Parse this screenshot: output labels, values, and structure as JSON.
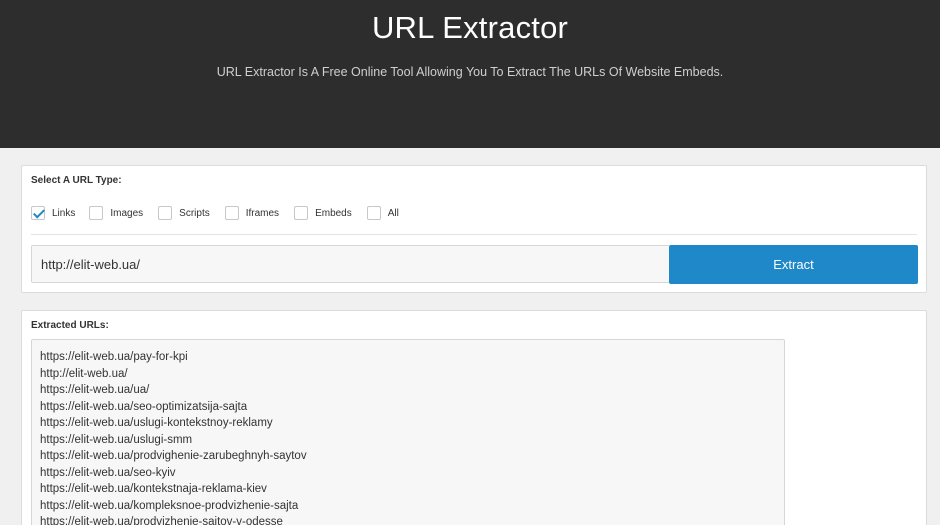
{
  "header": {
    "title": "URL Extractor",
    "subtitle": "URL Extractor Is A Free Online Tool Allowing You To Extract The URLs Of Website Embeds."
  },
  "url_type": {
    "label": "Select A URL Type:",
    "options": [
      {
        "label": "Links",
        "checked": true
      },
      {
        "label": "Images",
        "checked": false
      },
      {
        "label": "Scripts",
        "checked": false
      },
      {
        "label": "Iframes",
        "checked": false
      },
      {
        "label": "Embeds",
        "checked": false
      },
      {
        "label": "All",
        "checked": false
      }
    ]
  },
  "input": {
    "value": "http://elit-web.ua/"
  },
  "extract_button": {
    "label": "Extract"
  },
  "results": {
    "label": "Extracted URLs:",
    "urls": [
      "https://elit-web.ua/pay-for-kpi",
      "http://elit-web.ua/",
      "https://elit-web.ua/ua/",
      "https://elit-web.ua/seo-optimizatsija-sajta",
      "https://elit-web.ua/uslugi-kontekstnoy-reklamy",
      "https://elit-web.ua/uslugi-smm",
      "https://elit-web.ua/prodvighenie-zarubeghnyh-saytov",
      "https://elit-web.ua/seo-kyiv",
      "https://elit-web.ua/kontekstnaja-reklama-kiev",
      "https://elit-web.ua/kompleksnoe-prodvizhenie-sajta",
      "https://elit-web.ua/prodvizhenie-sajtov-v-odesse"
    ]
  },
  "colors": {
    "header_bg": "#2d2d2d",
    "accent": "#1e88c9",
    "page_bg": "#f0f0f0"
  }
}
